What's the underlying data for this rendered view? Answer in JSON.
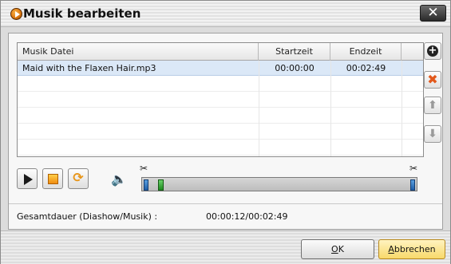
{
  "window": {
    "title": "Musik bearbeiten",
    "close_glyph": "✕"
  },
  "list": {
    "columns": [
      "Musik Datei",
      "Startzeit",
      "Endzeit",
      ""
    ],
    "rows": [
      {
        "file": "Maid with the Flaxen Hair.mp3",
        "start": "00:00:00",
        "end": "00:02:49",
        "selected": true
      }
    ]
  },
  "side_buttons": {
    "add_glyph": "+",
    "delete_glyph": "✖",
    "up_glyph": "⬆",
    "down_glyph": "⬇"
  },
  "playback": {
    "loop_glyph": "⟳",
    "speaker_glyph": "🔈",
    "scissor_glyph": "✂",
    "timeline_position_fraction": 0.03
  },
  "duration": {
    "label": "Gesamtdauer (Diashow/Musik) :",
    "value": "00:00:12/00:02:49"
  },
  "footer": {
    "ok_accel": "O",
    "ok_rest": "K",
    "cancel_accel": "A",
    "cancel_rest": "bbrechen"
  },
  "colors": {
    "accent_orange": "#f08c10",
    "selected_row": "#dbe8f7",
    "cancel_button": "#f8d96a"
  }
}
